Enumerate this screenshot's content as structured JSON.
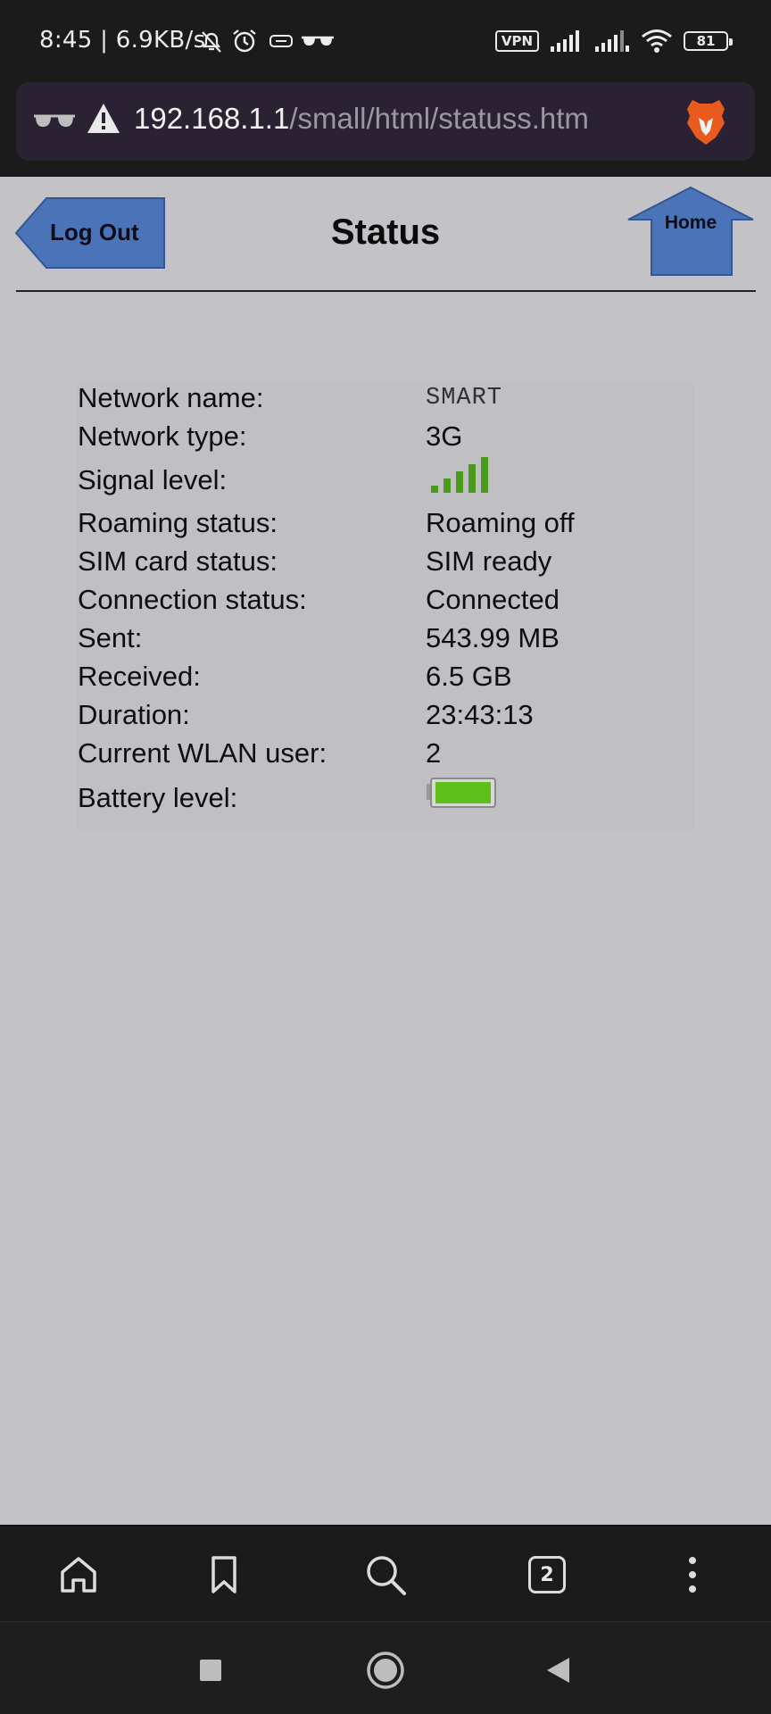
{
  "status_bar": {
    "time_speed": "8:45 | 6.9KB/s",
    "vpn_label": "VPN",
    "battery_percent": "81"
  },
  "url_bar": {
    "host": "192.168.1.1",
    "path": "/small/html/statuss.htm"
  },
  "header": {
    "title": "Status",
    "logout_label": "Log Out",
    "home_label": "Home"
  },
  "status_table": {
    "rows": [
      {
        "label": "Network name:",
        "value": "SMART"
      },
      {
        "label": "Network type:",
        "value": "3G"
      },
      {
        "label": "Signal level:",
        "value": null,
        "signal_bars": 5,
        "signal_max": 5
      },
      {
        "label": "Roaming status:",
        "value": "Roaming off"
      },
      {
        "label": "SIM card status:",
        "value": "SIM ready"
      },
      {
        "label": "Connection status:",
        "value": "Connected"
      },
      {
        "label": "Sent:",
        "value": "543.99 MB"
      },
      {
        "label": "Received:",
        "value": "6.5 GB"
      },
      {
        "label": "Duration:",
        "value": "23:43:13"
      },
      {
        "label": "Current WLAN user:",
        "value": "2"
      },
      {
        "label": "Battery level:",
        "value": null,
        "battery_fill": 1.0
      }
    ]
  },
  "toolbar": {
    "tab_count": "2",
    "icons": [
      "home-icon",
      "bookmark-icon",
      "search-icon",
      "tabs-icon",
      "more-vertical-icon"
    ]
  },
  "nav_bar": {
    "icons": [
      "recents-square-icon",
      "home-circle-icon",
      "back-triangle-icon"
    ]
  },
  "colors": {
    "page_bg": "#c3c3c7",
    "button_blue": "#4b73b8",
    "signal_green": "#4a9a1c",
    "battery_green": "#5fbf1a",
    "chrome_dark": "#1b1b1b"
  }
}
